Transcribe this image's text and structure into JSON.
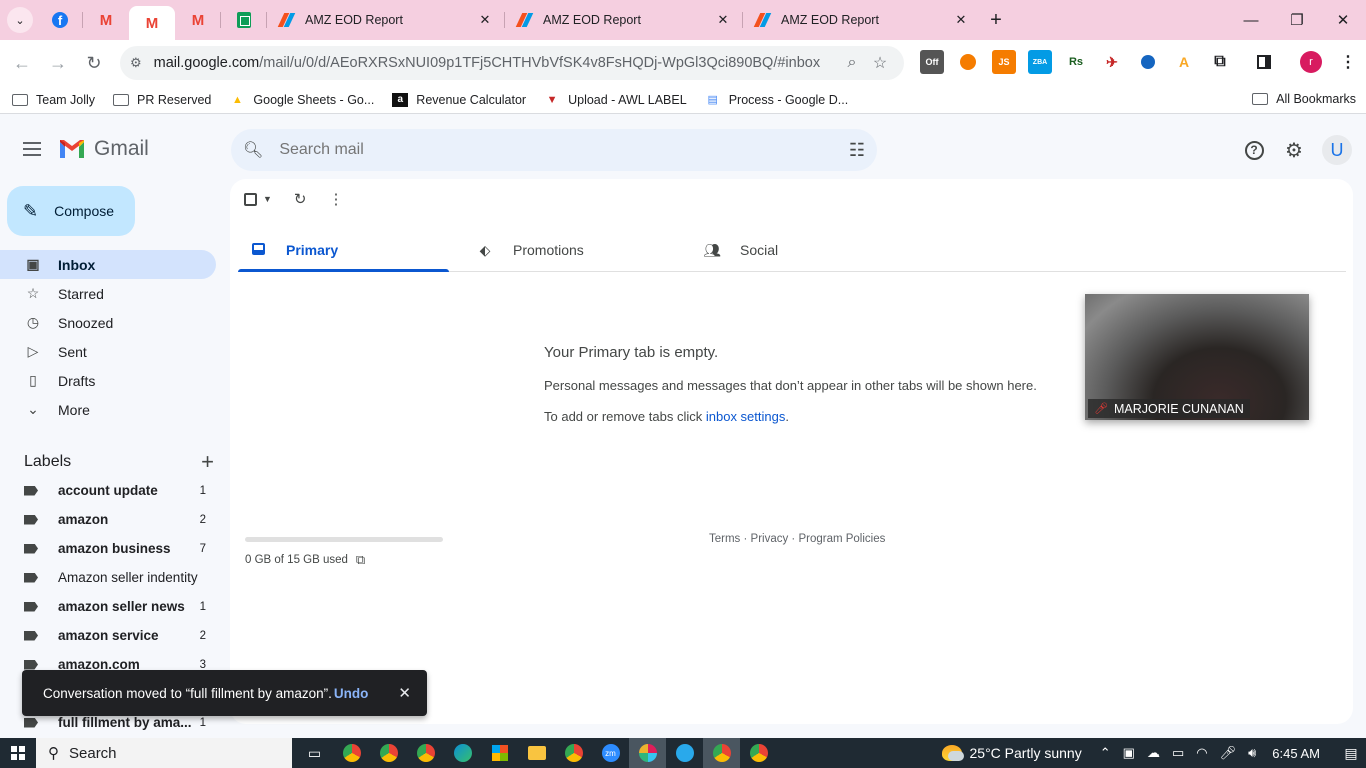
{
  "browser": {
    "tabs": [
      {
        "title": "AMZ EOD Report"
      },
      {
        "title": "AMZ EOD Report"
      },
      {
        "title": "AMZ EOD Report"
      }
    ],
    "url_domain": "mail.google.com",
    "url_path": "/mail/u/0/d/AEoRXRSxNUI09p1TFj5CHTHVbVfSK4v8FsHQDj-WpGl3Qci890BQ/#inbox",
    "profile_initial": "r",
    "bookmarks": [
      {
        "label": "Team Jolly",
        "icon": "folder-icon"
      },
      {
        "label": "PR Reserved",
        "icon": "folder-icon"
      },
      {
        "label": "Google Sheets - Go...",
        "icon": "google-drive-icon"
      },
      {
        "label": "Revenue Calculator",
        "icon": "amazon-icon"
      },
      {
        "label": "Upload - AWL LABEL",
        "icon": "awl-icon"
      },
      {
        "label": "Process - Google D...",
        "icon": "google-docs-icon"
      }
    ],
    "all_bookmarks": "All Bookmarks",
    "extensions": [
      "Off",
      "JS",
      "ZBA",
      "Rs"
    ]
  },
  "gmail": {
    "brand": "Gmail",
    "search_placeholder": "Search mail",
    "avatar_initial": "U",
    "compose_label": "Compose",
    "nav": [
      {
        "label": "Inbox",
        "icon": "inbox-icon"
      },
      {
        "label": "Starred",
        "icon": "star-icon"
      },
      {
        "label": "Snoozed",
        "icon": "clock-icon"
      },
      {
        "label": "Sent",
        "icon": "send-icon"
      },
      {
        "label": "Drafts",
        "icon": "draft-icon"
      },
      {
        "label": "More",
        "icon": "chevron-down-icon"
      }
    ],
    "labels_heading": "Labels",
    "labels": [
      {
        "name": "account update",
        "count": "1",
        "bold": true
      },
      {
        "name": "amazon",
        "count": "2",
        "bold": true
      },
      {
        "name": "amazon business",
        "count": "7",
        "bold": true
      },
      {
        "name": "Amazon seller indentity",
        "count": "",
        "bold": false
      },
      {
        "name": "amazon seller news",
        "count": "1",
        "bold": true
      },
      {
        "name": "amazon service",
        "count": "2",
        "bold": true
      },
      {
        "name": "amazon.com",
        "count": "3",
        "bold": true
      },
      {
        "name": "",
        "count": "",
        "bold": false
      },
      {
        "name": "full fillment by ama...",
        "count": "1",
        "bold": true
      }
    ],
    "tabs": [
      {
        "label": "Primary"
      },
      {
        "label": "Promotions"
      },
      {
        "label": "Social"
      }
    ],
    "empty_title": "Your Primary tab is empty.",
    "empty_desc": "Personal messages and messages that don’t appear in other tabs will be shown here.",
    "empty_settings_prefix": "To add or remove tabs click ",
    "empty_settings_link": "inbox settings",
    "empty_settings_suffix": ".",
    "storage_text": "0 GB of 15 GB used",
    "storage_fraction": 0.0,
    "footer": "Terms · Privacy · Program Policies",
    "video_participant": "MARJORIE CUNANAN",
    "snackbar": {
      "message": "Conversation moved to “full fillment by amazon”.",
      "action": "Undo"
    }
  },
  "taskbar": {
    "search_label": "Search",
    "weather": "25°C  Partly sunny",
    "time": "6:45 AM"
  },
  "colors": {
    "tabstrip": "#f5cfe0",
    "compose": "#c2e7ff",
    "nav_active": "#d3e3fd",
    "accent": "#0b57d0"
  }
}
